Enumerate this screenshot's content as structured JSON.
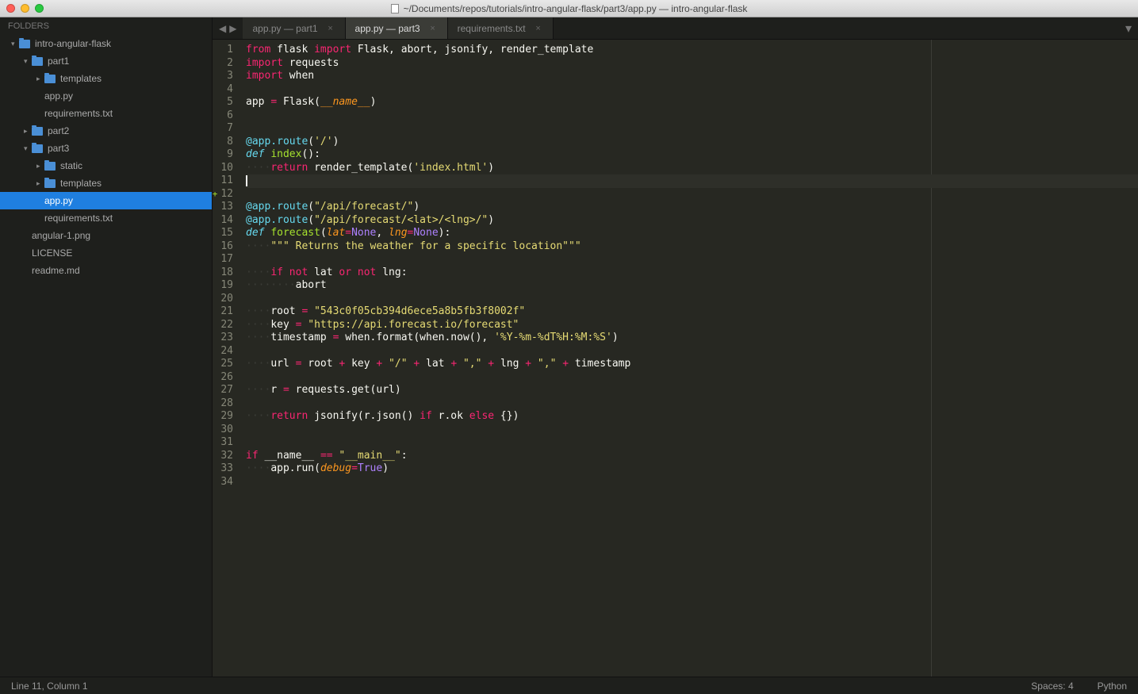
{
  "window": {
    "title": "~/Documents/repos/tutorials/intro-angular-flask/part3/app.py — intro-angular-flask"
  },
  "sidebar": {
    "header": "FOLDERS",
    "tree": [
      {
        "label": "intro-angular-flask",
        "type": "folder",
        "indent": 0,
        "open": true
      },
      {
        "label": "part1",
        "type": "folder",
        "indent": 1,
        "open": true
      },
      {
        "label": "templates",
        "type": "folder",
        "indent": 2,
        "open": false
      },
      {
        "label": "app.py",
        "type": "file",
        "indent": 2
      },
      {
        "label": "requirements.txt",
        "type": "file",
        "indent": 2
      },
      {
        "label": "part2",
        "type": "folder",
        "indent": 1,
        "open": false
      },
      {
        "label": "part3",
        "type": "folder",
        "indent": 1,
        "open": true
      },
      {
        "label": "static",
        "type": "folder",
        "indent": 2,
        "open": false
      },
      {
        "label": "templates",
        "type": "folder",
        "indent": 2,
        "open": false
      },
      {
        "label": "app.py",
        "type": "file",
        "indent": 2,
        "selected": true
      },
      {
        "label": "requirements.txt",
        "type": "file",
        "indent": 2
      },
      {
        "label": "angular-1.png",
        "type": "file",
        "indent": 1
      },
      {
        "label": "LICENSE",
        "type": "file",
        "indent": 1
      },
      {
        "label": "readme.md",
        "type": "file",
        "indent": 1
      }
    ]
  },
  "tabs": [
    {
      "label": "app.py — part1",
      "active": false
    },
    {
      "label": "app.py — part3",
      "active": true
    },
    {
      "label": "requirements.txt",
      "active": false
    }
  ],
  "editor": {
    "gutter_mark_line": 12,
    "cursor_line": 11,
    "lines": [
      {
        "n": 1,
        "t": [
          [
            "kw",
            "from"
          ],
          [
            "",
            " flask "
          ],
          [
            "kw",
            "import"
          ],
          [
            "",
            " Flask, abort, jsonify, render_template"
          ]
        ]
      },
      {
        "n": 2,
        "t": [
          [
            "kw",
            "import"
          ],
          [
            "",
            " requests"
          ]
        ]
      },
      {
        "n": 3,
        "t": [
          [
            "kw",
            "import"
          ],
          [
            "",
            " when"
          ]
        ]
      },
      {
        "n": 4,
        "t": []
      },
      {
        "n": 5,
        "t": [
          [
            "",
            "app "
          ],
          [
            "op",
            "="
          ],
          [
            "",
            " Flask("
          ],
          [
            "pa",
            "__name__"
          ],
          [
            "",
            ")"
          ]
        ]
      },
      {
        "n": 6,
        "t": []
      },
      {
        "n": 7,
        "t": []
      },
      {
        "n": 8,
        "t": [
          [
            "dec",
            "@app.route"
          ],
          [
            "",
            "("
          ],
          [
            "st",
            "'/'"
          ],
          [
            "",
            ")"
          ]
        ]
      },
      {
        "n": 9,
        "t": [
          [
            "fn",
            "def"
          ],
          [
            "",
            " "
          ],
          [
            "nm",
            "index"
          ],
          [
            "",
            "():"
          ]
        ]
      },
      {
        "n": 10,
        "t": [
          [
            "ws",
            "····"
          ],
          [
            "kw",
            "return"
          ],
          [
            "",
            " render_template("
          ],
          [
            "st",
            "'index.html'"
          ],
          [
            "",
            ")"
          ]
        ]
      },
      {
        "n": 11,
        "hl": true,
        "cursor": true,
        "t": []
      },
      {
        "n": 12,
        "t": []
      },
      {
        "n": 13,
        "t": [
          [
            "dec",
            "@app.route"
          ],
          [
            "",
            "("
          ],
          [
            "st",
            "\"/api/forecast/\""
          ],
          [
            "",
            ")"
          ]
        ]
      },
      {
        "n": 14,
        "t": [
          [
            "dec",
            "@app.route"
          ],
          [
            "",
            "("
          ],
          [
            "st",
            "\"/api/forecast/<lat>/<lng>/\""
          ],
          [
            "",
            ")"
          ]
        ]
      },
      {
        "n": 15,
        "t": [
          [
            "fn",
            "def"
          ],
          [
            "",
            " "
          ],
          [
            "nm",
            "forecast"
          ],
          [
            "",
            "("
          ],
          [
            "pa",
            "lat"
          ],
          [
            "op",
            "="
          ],
          [
            "nu",
            "None"
          ],
          [
            "",
            ", "
          ],
          [
            "pa",
            "lng"
          ],
          [
            "op",
            "="
          ],
          [
            "nu",
            "None"
          ],
          [
            "",
            "):"
          ]
        ]
      },
      {
        "n": 16,
        "t": [
          [
            "ws",
            "····"
          ],
          [
            "st",
            "\"\"\" Returns the weather for a specific location\"\"\""
          ]
        ]
      },
      {
        "n": 17,
        "t": []
      },
      {
        "n": 18,
        "t": [
          [
            "ws",
            "····"
          ],
          [
            "kw",
            "if"
          ],
          [
            "",
            " "
          ],
          [
            "kw",
            "not"
          ],
          [
            "",
            " lat "
          ],
          [
            "kw",
            "or"
          ],
          [
            "",
            " "
          ],
          [
            "kw",
            "not"
          ],
          [
            "",
            " lng:"
          ]
        ]
      },
      {
        "n": 19,
        "t": [
          [
            "ws",
            "········"
          ],
          [
            "",
            "abort"
          ]
        ]
      },
      {
        "n": 20,
        "t": []
      },
      {
        "n": 21,
        "t": [
          [
            "ws",
            "····"
          ],
          [
            "",
            "root "
          ],
          [
            "op",
            "="
          ],
          [
            "",
            " "
          ],
          [
            "st",
            "\"543c0f05cb394d6ece5a8b5fb3f8002f\""
          ]
        ]
      },
      {
        "n": 22,
        "t": [
          [
            "ws",
            "····"
          ],
          [
            "",
            "key "
          ],
          [
            "op",
            "="
          ],
          [
            "",
            " "
          ],
          [
            "st",
            "\"https://api.forecast.io/forecast\""
          ]
        ]
      },
      {
        "n": 23,
        "t": [
          [
            "ws",
            "····"
          ],
          [
            "",
            "timestamp "
          ],
          [
            "op",
            "="
          ],
          [
            "",
            " when.format(when.now(), "
          ],
          [
            "st",
            "'%Y-%m-%dT%H:%M:%S'"
          ],
          [
            "",
            ")"
          ]
        ]
      },
      {
        "n": 24,
        "t": []
      },
      {
        "n": 25,
        "t": [
          [
            "ws",
            "····"
          ],
          [
            "",
            "url "
          ],
          [
            "op",
            "="
          ],
          [
            "",
            " root "
          ],
          [
            "op",
            "+"
          ],
          [
            "",
            " key "
          ],
          [
            "op",
            "+"
          ],
          [
            "",
            " "
          ],
          [
            "st",
            "\"/\""
          ],
          [
            "",
            " "
          ],
          [
            "op",
            "+"
          ],
          [
            "",
            " lat "
          ],
          [
            "op",
            "+"
          ],
          [
            "",
            " "
          ],
          [
            "st",
            "\",\""
          ],
          [
            "",
            " "
          ],
          [
            "op",
            "+"
          ],
          [
            "",
            " lng "
          ],
          [
            "op",
            "+"
          ],
          [
            "",
            " "
          ],
          [
            "st",
            "\",\""
          ],
          [
            "",
            " "
          ],
          [
            "op",
            "+"
          ],
          [
            "",
            " timestamp"
          ]
        ]
      },
      {
        "n": 26,
        "t": []
      },
      {
        "n": 27,
        "t": [
          [
            "ws",
            "····"
          ],
          [
            "",
            "r "
          ],
          [
            "op",
            "="
          ],
          [
            "",
            " requests.get(url)"
          ]
        ]
      },
      {
        "n": 28,
        "t": []
      },
      {
        "n": 29,
        "t": [
          [
            "ws",
            "····"
          ],
          [
            "kw",
            "return"
          ],
          [
            "",
            " jsonify(r.json() "
          ],
          [
            "kw",
            "if"
          ],
          [
            "",
            " r.ok "
          ],
          [
            "kw",
            "else"
          ],
          [
            "",
            " {})"
          ]
        ]
      },
      {
        "n": 30,
        "t": []
      },
      {
        "n": 31,
        "t": []
      },
      {
        "n": 32,
        "t": [
          [
            "kw",
            "if"
          ],
          [
            "",
            " __name__ "
          ],
          [
            "op",
            "=="
          ],
          [
            "",
            " "
          ],
          [
            "st",
            "\"__main__\""
          ],
          [
            "",
            ":"
          ]
        ]
      },
      {
        "n": 33,
        "t": [
          [
            "ws",
            "····"
          ],
          [
            "",
            "app.run("
          ],
          [
            "pa",
            "debug"
          ],
          [
            "op",
            "="
          ],
          [
            "nu",
            "True"
          ],
          [
            "",
            ")"
          ]
        ]
      },
      {
        "n": 34,
        "t": []
      }
    ]
  },
  "status": {
    "left": "Line 11, Column 1",
    "spaces": "Spaces: 4",
    "lang": "Python"
  }
}
